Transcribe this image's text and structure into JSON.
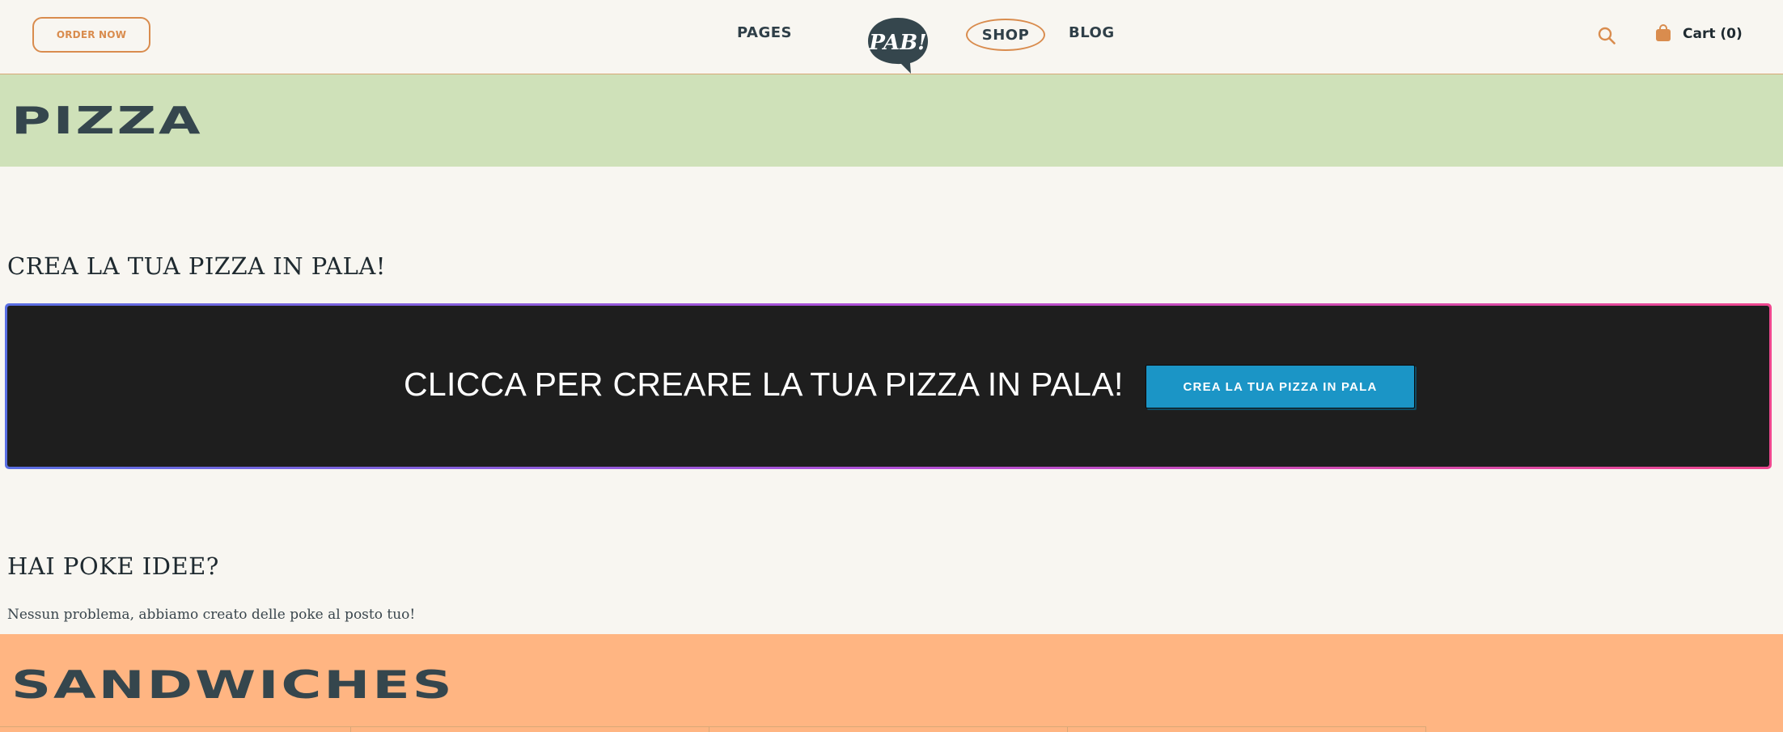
{
  "header": {
    "order_now": "ORDER NOW",
    "nav": {
      "pages": "PAGES",
      "shop": "SHOP",
      "blog": "BLOG"
    },
    "logo_text": "PAB!",
    "cart_label": "Cart (0)",
    "icons": {
      "search": "search-icon",
      "cart": "shopping-bag-icon"
    }
  },
  "pizza_band": {
    "title": "PIZZA"
  },
  "section_pizza": {
    "title": "CREA LA TUA PIZZA IN PALA!",
    "banner_text": "CLICCA PER CREARE LA TUA PIZZA IN PALA!",
    "banner_button": "CREA LA TUA PIZZA IN PALA"
  },
  "section_poke": {
    "title": "HAI POKE IDEE?",
    "subtitle": "Nessun problema, abbiamo creato delle poke al posto tuo!"
  },
  "sandwich_band": {
    "title": "SANDWICHES"
  },
  "colors": {
    "accent": "#d98c4e",
    "pizza_band": "#cfe1b9",
    "sandwich_band": "#ffb582",
    "banner_bg": "#1e1e1e",
    "button": "#1b95c6",
    "text_dark": "#35464d"
  }
}
